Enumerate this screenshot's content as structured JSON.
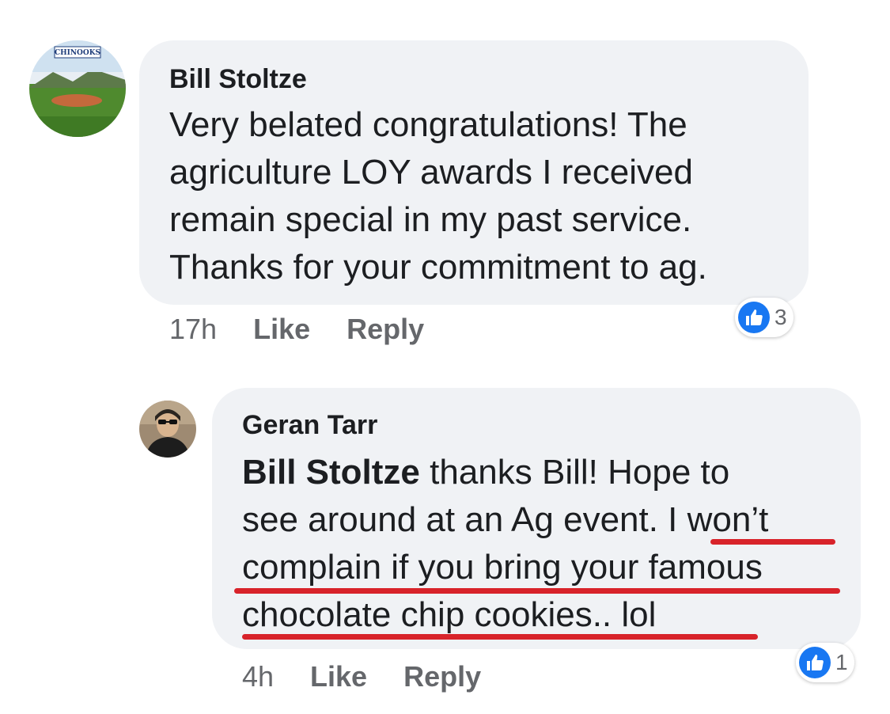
{
  "comments": [
    {
      "author": "Bill Stoltze",
      "avatar_label": "CHINOOKS",
      "lines": [
        "Very belated congratulations!  The",
        "agriculture LOY awards I received",
        "remain special in my past service.",
        "Thanks for your commitment to ag."
      ],
      "time": "17h",
      "like_label": "Like",
      "reply_label": "Reply",
      "reaction_count": "3"
    },
    {
      "author": "Geran Tarr",
      "mention": "Bill Stoltze",
      "lines": [
        " thanks Bill! Hope to",
        "see around at an Ag event. I won’t",
        "complain if you bring your famous",
        "chocolate chip cookies.. lol"
      ],
      "time": "4h",
      "like_label": "Like",
      "reply_label": "Reply",
      "reaction_count": "1"
    }
  ],
  "colors": {
    "bubble": "#f0f2f5",
    "like_blue": "#1877f2",
    "underline_red": "#d8232a",
    "meta_gray": "#65676b"
  },
  "icons": [
    "thumbs-up-icon",
    "baseball-field-avatar",
    "person-avatar"
  ]
}
